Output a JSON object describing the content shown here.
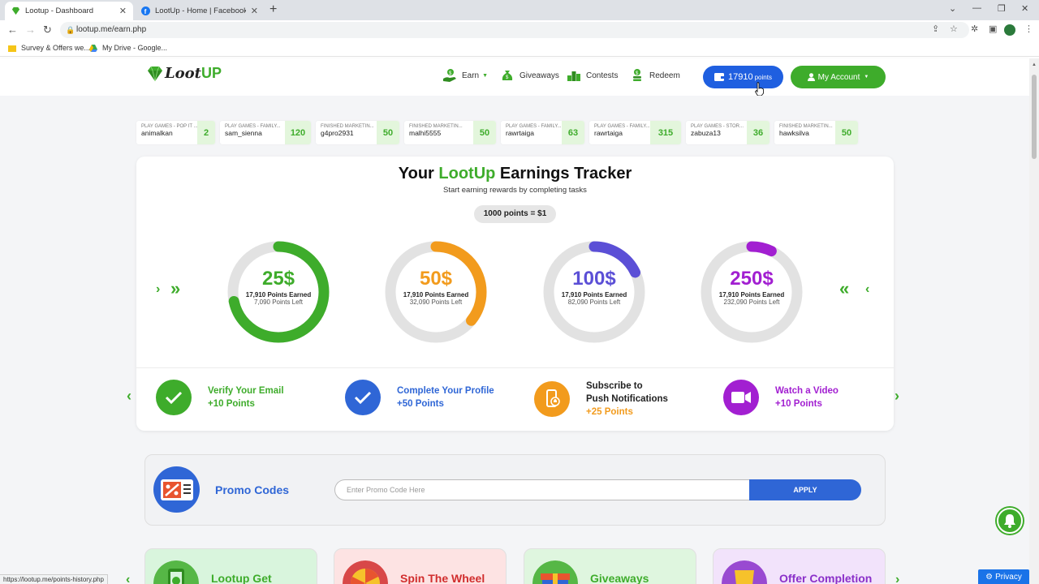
{
  "browser": {
    "tabs": [
      {
        "title": "Lootup - Dashboard",
        "active": true
      },
      {
        "title": "LootUp - Home | Facebook",
        "active": false
      }
    ],
    "url": "lootup.me/earn.php",
    "bookmarks": [
      "Survey & Offers we...",
      "My Drive - Google..."
    ],
    "status_url": "https://lootup.me/points-history.php"
  },
  "header": {
    "logo_prefix": "Loot",
    "logo_suffix": "UP",
    "nav": [
      {
        "label": "Earn",
        "icon": "earn-hand-coin-icon",
        "dropdown": true
      },
      {
        "label": "Giveaways",
        "icon": "money-bag-icon",
        "dropdown": false
      },
      {
        "label": "Contests",
        "icon": "podium-icon",
        "dropdown": false
      },
      {
        "label": "Redeem",
        "icon": "dollar-coin-stack-icon",
        "dropdown": false
      }
    ],
    "points_value": "17910",
    "points_unit": "points",
    "account_label": "My Account"
  },
  "ticker": [
    {
      "label": "PLAY GAMES - POP IT ...",
      "user": "animalkan",
      "points": "2"
    },
    {
      "label": "PLAY GAMES - FAMILY...",
      "user": "sam_sienna",
      "points": "120"
    },
    {
      "label": "FINISHED MARKETIN...",
      "user": "g4pro2931",
      "points": "50"
    },
    {
      "label": "FINISHED MARKETIN...",
      "user": "malhi5555",
      "points": "50"
    },
    {
      "label": "PLAY GAMES - FAMILY...",
      "user": "rawrtaiga",
      "points": "63"
    },
    {
      "label": "PLAY GAMES - FAMILY...",
      "user": "rawrtaiga",
      "points": "315"
    },
    {
      "label": "PLAY GAMES - STOR...",
      "user": "zabuza13",
      "points": "36"
    },
    {
      "label": "FINISHED MARKETIN...",
      "user": "hawksilva",
      "points": "50"
    }
  ],
  "tracker": {
    "title_prefix": "Your ",
    "title_brand": "LootUp",
    "title_suffix": " Earnings Tracker",
    "subtitle": "Start earning rewards by completing tasks",
    "rate": "1000 points = $1",
    "goals": [
      {
        "amount": "25$",
        "earned": "17,910 Points Earned",
        "left": "7,090 Points Left",
        "progress": 0.7164,
        "color": "#3eac2b"
      },
      {
        "amount": "50$",
        "earned": "17,910 Points Earned",
        "left": "32,090 Points Left",
        "progress": 0.3582,
        "color": "#f29b1d"
      },
      {
        "amount": "100$",
        "earned": "17,910 Points Earned",
        "left": "82,090 Points Left",
        "progress": 0.1791,
        "color": "#5b4fd6"
      },
      {
        "amount": "250$",
        "earned": "17,910 Points Earned",
        "left": "232,090 Points Left",
        "progress": 0.0716,
        "color": "#a21fd1"
      }
    ]
  },
  "tasks": [
    {
      "line1": "Verify Your Email",
      "line2": "",
      "reward": "+10 Points",
      "color": "#3eac2b",
      "icon": "checkmark-icon"
    },
    {
      "line1": "Complete Your Profile",
      "line2": "",
      "reward": "+50 Points",
      "color": "#2f66d6",
      "icon": "checkmark-icon"
    },
    {
      "line1": "Subscribe to",
      "line2": "Push Notifications",
      "reward": "+25 Points",
      "color": "#f29b1d",
      "icon": "phone-notification-icon"
    },
    {
      "line1": "Watch a Video",
      "line2": "",
      "reward": "+10 Points",
      "color": "#a21fd1",
      "icon": "video-camera-icon"
    }
  ],
  "promo": {
    "title": "Promo Codes",
    "placeholder": "Enter Promo Code Here",
    "apply": "APPLY"
  },
  "features": [
    {
      "title": "Lootup Get",
      "color": "#3eac2b",
      "bg": "#d9f5dd",
      "icon": "phone-money-icon"
    },
    {
      "title": "Spin The Wheel",
      "color": "#d12d2d",
      "bg": "#fde3e3",
      "icon": "prize-wheel-icon"
    },
    {
      "title": "Giveaways",
      "color": "#3eac2b",
      "bg": "#dff6df",
      "icon": "gift-box-icon"
    },
    {
      "title": "Offer Completion",
      "color": "#8a2fc9",
      "bg": "#f2e3fb",
      "icon": "trophy-icon"
    }
  ],
  "privacy_label": "Privacy"
}
